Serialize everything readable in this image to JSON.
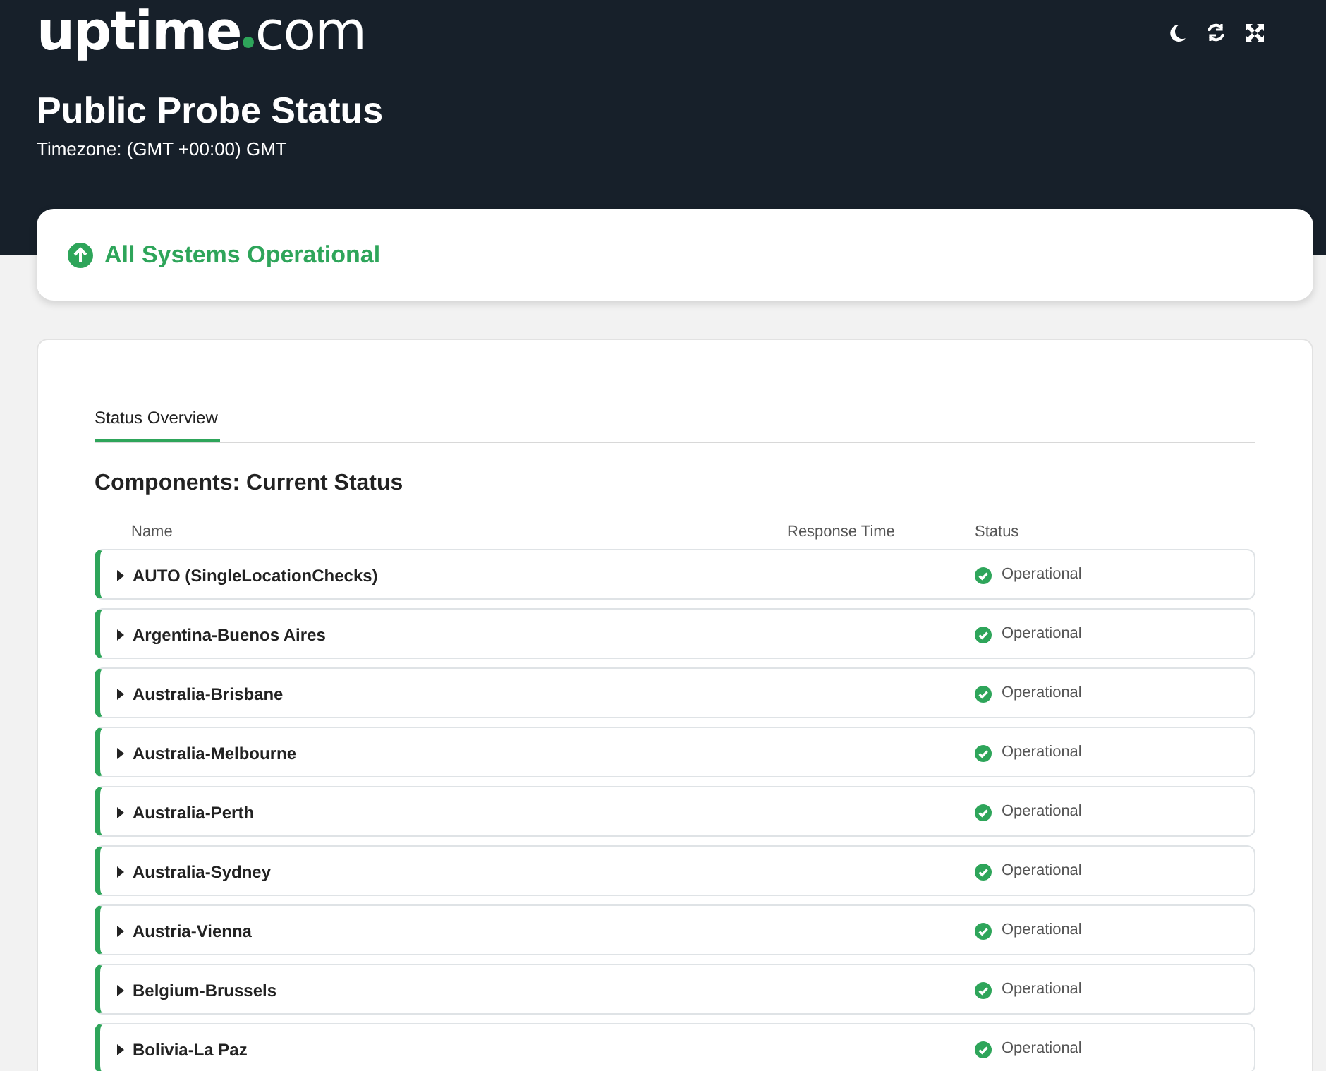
{
  "header": {
    "logo": {
      "word": "uptime",
      "domain": "com"
    },
    "title": "Public Probe Status",
    "timezone": "Timezone: (GMT +00:00) GMT"
  },
  "summary": {
    "text": "All Systems Operational"
  },
  "tabs": [
    {
      "label": "Status Overview",
      "selected": true
    }
  ],
  "components": {
    "heading": "Components: Current Status",
    "columns": [
      "Name",
      "Response Time",
      "Status"
    ],
    "rows": [
      {
        "name": "AUTO (SingleLocationChecks)",
        "status": "Operational",
        "expanded": false
      },
      {
        "name": "Argentina-Buenos Aires",
        "status": "Operational",
        "expanded": false
      },
      {
        "name": "Australia-Brisbane",
        "status": "Operational",
        "expanded": false
      },
      {
        "name": "Australia-Melbourne",
        "status": "Operational",
        "expanded": false
      },
      {
        "name": "Australia-Perth",
        "status": "Operational",
        "expanded": false
      },
      {
        "name": "Australia-Sydney",
        "status": "Operational",
        "expanded": false
      },
      {
        "name": "Austria-Vienna",
        "status": "Operational",
        "expanded": false
      },
      {
        "name": "Belgium-Brussels",
        "status": "Operational",
        "expanded": false
      },
      {
        "name": "Bolivia-La Paz",
        "status": "Operational",
        "expanded": false
      }
    ]
  }
}
